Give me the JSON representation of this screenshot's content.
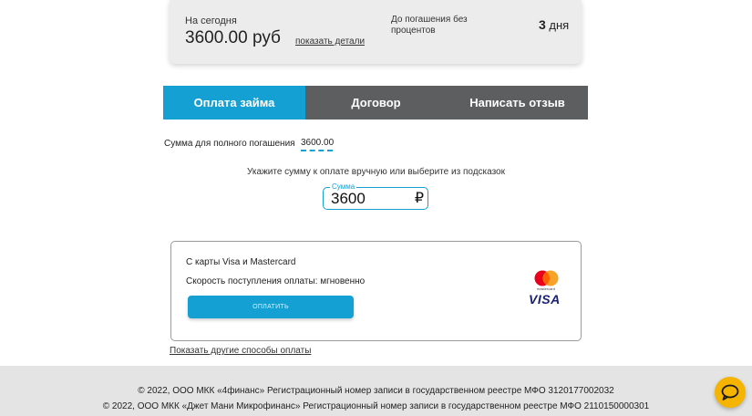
{
  "summary": {
    "today_label": "На сегодня",
    "today_amount": "3600.00 руб",
    "details_link": "показать детали",
    "interest_free_label": "До погашения без процентов",
    "days_number": "3",
    "days_unit": "дня"
  },
  "tabs": [
    {
      "label": "Оплата займа",
      "active": true
    },
    {
      "label": "Договор",
      "active": false
    },
    {
      "label": "Написать отзыв",
      "active": false
    }
  ],
  "repayment": {
    "full_label": "Сумма для полного погашения",
    "full_value": "3600.00",
    "hint": "Укажите сумму к оплате вручную или выберите из подсказок",
    "amount_legend": "Сумма",
    "amount_value": "3600",
    "currency_symbol": "₽"
  },
  "payment_method": {
    "title": "С карты Visa и Mastercard",
    "speed": "Скорость поступления оплаты: мгновенно",
    "pay_button": "ОПЛАТИТЬ",
    "mastercard_text": "mastercard",
    "visa_text": "VISA"
  },
  "other_methods_link": "Показать другие способы оплаты",
  "footer": {
    "line1": "© 2022, ООО МКК «4финанс» Регистрационный номер записи в государственном реестре МФО 3120177002032",
    "line2": "© 2022, ООО МКК «Джет Мани Микрофинанс» Регистрационный номер записи в государственном реестре МФО 2110150000301"
  },
  "colors": {
    "accent": "#14a0d2",
    "tab_inactive": "#5d5e60",
    "chat_button": "#f5b400"
  },
  "icons": {
    "chat": "chat-bubble-icon",
    "mastercard": "mastercard-logo",
    "visa": "visa-logo",
    "cursor": "mouse-cursor-icon"
  }
}
